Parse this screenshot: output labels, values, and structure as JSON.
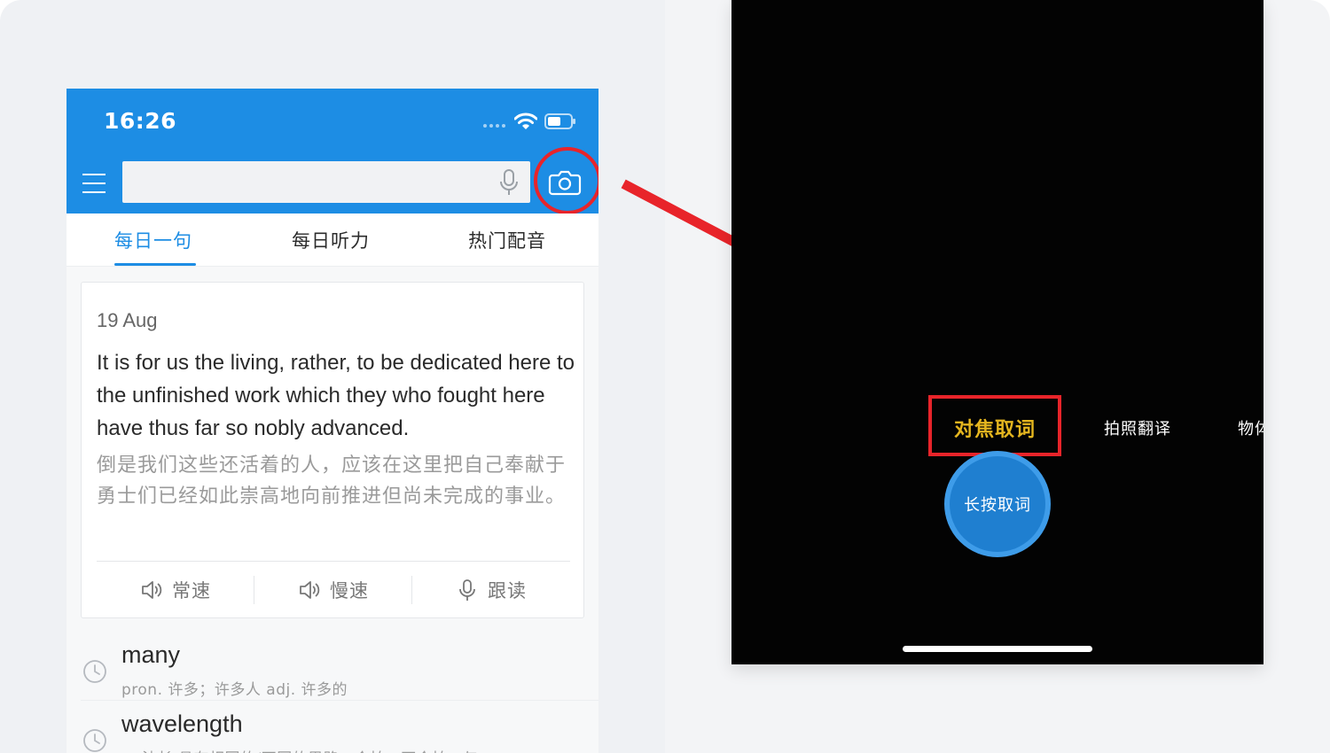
{
  "left_phone": {
    "status": {
      "time": "16:26"
    },
    "search": {
      "placeholder": ""
    },
    "tabs": [
      {
        "label": "每日一句",
        "active": true
      },
      {
        "label": "每日听力",
        "active": false
      },
      {
        "label": "热门配音",
        "active": false
      }
    ],
    "card": {
      "date": "19 Aug",
      "sentence_en": "It is for us the living, rather, to be dedicated here to the unfinished work which they who fought here have thus far so nobly advanced.",
      "sentence_cn": "倒是我们这些还活着的人，应该在这里把自己奉献于勇士们已经如此崇高地向前推进但尚未完成的事业。",
      "audio_buttons": [
        {
          "label": "常速",
          "icon": "speaker-icon"
        },
        {
          "label": "慢速",
          "icon": "speaker-icon"
        },
        {
          "label": "跟读",
          "icon": "mic-icon"
        }
      ]
    },
    "history": [
      {
        "word": "many",
        "definition": "pron. 许多；许多人 adj. 许多的"
      },
      {
        "word": "wavelength",
        "definition": "n. 波长 具有相同的/不同的思路；合拍；不合拍；与"
      }
    ]
  },
  "right_phone": {
    "modes": {
      "active": "对焦取词",
      "second": "拍照翻译",
      "third": "物体"
    },
    "shutter_label": "长按取词"
  },
  "colors": {
    "brand_blue": "#1d8de4",
    "highlight_red": "#e8242a",
    "mode_active": "#e5b61f"
  }
}
